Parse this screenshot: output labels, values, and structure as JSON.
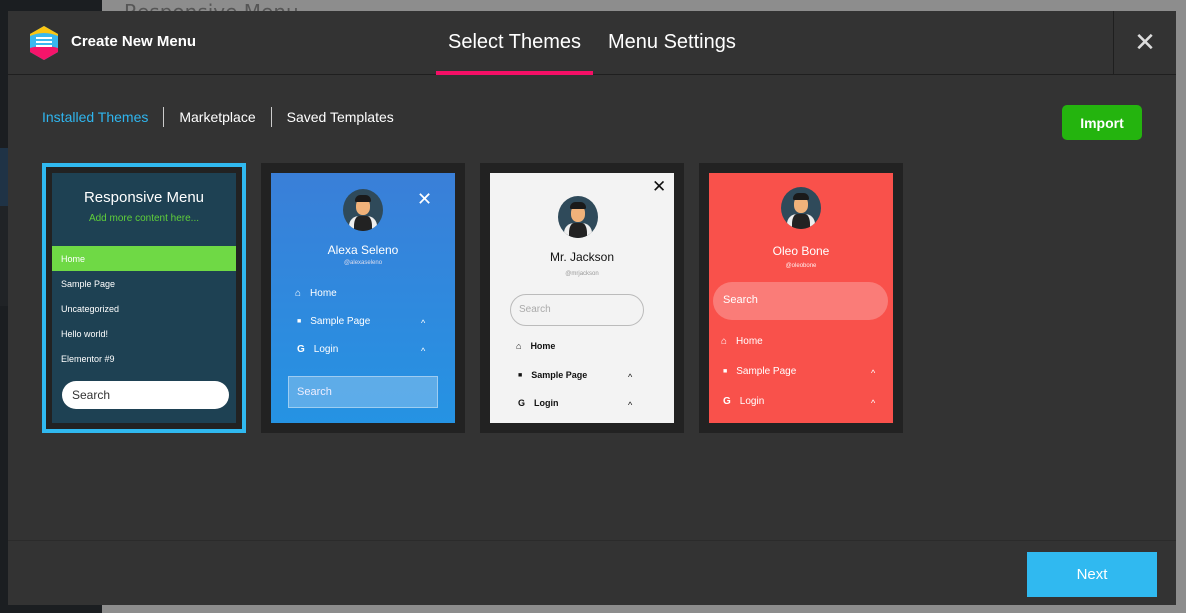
{
  "background": {
    "page_title": "Responsive Menu"
  },
  "header": {
    "app_title": "Create New Menu",
    "tabs": [
      {
        "label": "Select Themes",
        "active": true
      },
      {
        "label": "Menu Settings",
        "active": false
      }
    ],
    "close_icon": "close-icon"
  },
  "subtabs": [
    {
      "label": "Installed Themes",
      "active": true
    },
    {
      "label": "Marketplace"
    },
    {
      "label": "Saved Templates"
    }
  ],
  "import_label": "Import",
  "themes": [
    {
      "title": "Responsive Menu",
      "subtitle": "Add more content here...",
      "items": [
        "Home",
        "Sample Page",
        "Uncategorized",
        "Hello world!",
        "Elementor #9"
      ],
      "search": "Search",
      "selected": true,
      "bg": "#1e4153",
      "active_color": "#6fd945"
    },
    {
      "name": "Alexa Seleno",
      "handle": "@alexaseleno",
      "items": [
        "Home",
        "Sample Page",
        "Login"
      ],
      "search": "Search",
      "bg": "#3580d8"
    },
    {
      "name": "Mr. Jackson",
      "handle": "@mrjackson",
      "items": [
        "Home",
        "Sample Page",
        "Login"
      ],
      "search": "Search",
      "bg": "#f3f3f3"
    },
    {
      "name": "Oleo Bone",
      "handle": "@oleobone",
      "items": [
        "Home",
        "Sample Page",
        "Login"
      ],
      "search": "Search",
      "bg": "#f9514b"
    }
  ],
  "next_label": "Next",
  "colors": {
    "accent": "#30b9f0",
    "tab_underline": "#f50f66",
    "import": "#24b40e"
  }
}
